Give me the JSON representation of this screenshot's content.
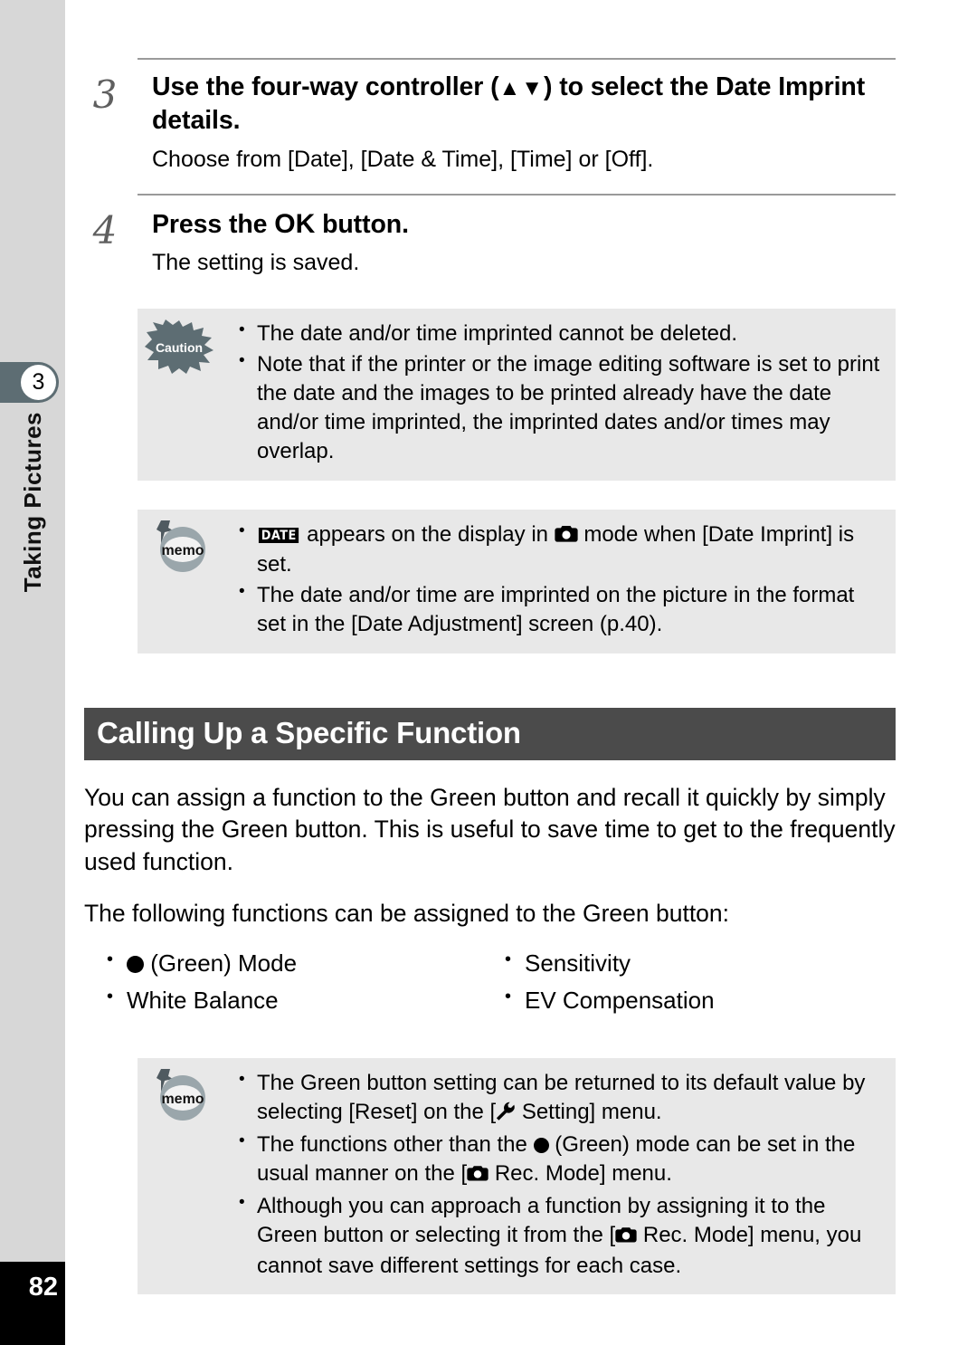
{
  "sidebar": {
    "chapter_number": "3",
    "chapter_title": "Taking Pictures",
    "page_number": "82"
  },
  "steps": [
    {
      "number": "3",
      "title_part1": "Use the four-way controller (",
      "title_arrows": "▲▼",
      "title_part2": ") to select the Date Imprint details.",
      "body": "Choose from [Date], [Date & Time], [Time] or [Off]."
    },
    {
      "number": "4",
      "title_part1": "Press the ",
      "title_ok": "OK",
      "title_part2": " button.",
      "body": "The setting is saved."
    }
  ],
  "caution_box": {
    "icon_label": "Caution",
    "items": [
      "The date and/or time imprinted cannot be deleted.",
      "Note that if the printer or the image editing software is set to print the date and the images to be printed already have the date and/or time imprinted, the imprinted dates and/or times may overlap."
    ]
  },
  "memo_box_top": {
    "icon_label": "memo",
    "item1_badge": "DATE",
    "item1_part1": " appears on the display in ",
    "item1_part2": " mode when [Date Imprint] is set.",
    "item2": "The date and/or time are imprinted on the picture in the format set in the [Date Adjustment] screen (p.40)."
  },
  "section": {
    "heading": "Calling Up a Specific Function",
    "paragraph1": "You can assign a function to the Green button and recall it quickly by simply pressing the Green button. This is useful to save time to get to the frequently used function.",
    "paragraph2": "The following functions can be assigned to the Green button:"
  },
  "feature_list": [
    {
      "has_dot": true,
      "label": " (Green) Mode"
    },
    {
      "has_dot": false,
      "label": "Sensitivity"
    },
    {
      "has_dot": false,
      "label": "White Balance"
    },
    {
      "has_dot": false,
      "label": "EV Compensation"
    }
  ],
  "memo_box_bottom": {
    "icon_label": "memo",
    "item1_part1": "The Green button setting can be returned to its default value by selecting [Reset] on the [",
    "item1_part2": " Setting] menu.",
    "item2_part1": "The functions other than the ",
    "item2_part2": " (Green) mode can be set in the usual manner on the [",
    "item2_part3": " Rec. Mode] menu.",
    "item3_part1": "Although you can approach a function by assigning it to the Green button or selecting it from the [",
    "item3_part2": " Rec. Mode] menu, you cannot save different settings for each case."
  },
  "colors": {
    "sidebar_bg": "#d7d7d7",
    "tab_bg": "#5d6d73",
    "notebox_bg": "#e8e8e8",
    "heading_bg": "#4b4b4b",
    "rule": "#9a9a9a"
  }
}
